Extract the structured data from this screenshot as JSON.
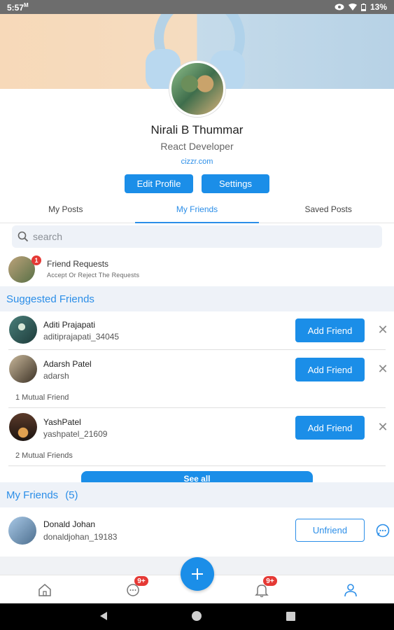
{
  "status_bar": {
    "time": "5:57",
    "time_suffix": "M",
    "battery": "13%"
  },
  "profile": {
    "name": "Nirali B Thummar",
    "role": "React Developer",
    "link": "cizzr.com",
    "edit_label": "Edit Profile",
    "settings_label": "Settings"
  },
  "tabs": [
    {
      "label": "My Posts",
      "active": false
    },
    {
      "label": "My Friends",
      "active": true
    },
    {
      "label": "Saved Posts",
      "active": false
    }
  ],
  "search": {
    "placeholder": "search"
  },
  "friend_requests": {
    "title": "Friend Requests",
    "subtitle": "Accept Or Reject The Requests",
    "badge": "1"
  },
  "suggested": {
    "heading": "Suggested Friends",
    "add_label": "Add Friend",
    "close_glyph": "✕",
    "see_all": "See all",
    "items": [
      {
        "name": "Aditi Prajapati",
        "handle": "aditiprajapati_34045",
        "mutual": ""
      },
      {
        "name": "Adarsh Patel",
        "handle": "adarsh",
        "mutual": "1 Mutual Friend"
      },
      {
        "name": "YashPatel",
        "handle": "yashpatel_21609",
        "mutual": "2 Mutual Friends"
      }
    ]
  },
  "friends": {
    "heading": "My Friends",
    "count": "(5)",
    "items": [
      {
        "name": "Donald Johan",
        "handle": "donaldjohan_19183",
        "unfriend_label": "Unfriend"
      }
    ]
  },
  "bottom_nav": {
    "chat_badge": "9+",
    "notif_badge": "9+",
    "fab_glyph": "+"
  },
  "colors": {
    "accent": "#1b8ee8",
    "badge": "#e53935",
    "section_bg": "#eef2f8"
  }
}
